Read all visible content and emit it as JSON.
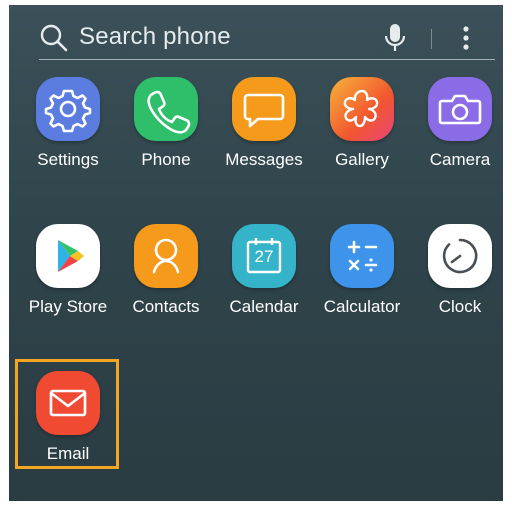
{
  "search": {
    "placeholder": "Search phone"
  },
  "icons": {
    "search": "search-icon",
    "mic": "mic-icon",
    "more": "more-vertical-icon"
  },
  "apps_row1": [
    {
      "label": "Settings",
      "icon": "gear-icon",
      "color": "#5b7de0"
    },
    {
      "label": "Phone",
      "icon": "phone-icon",
      "color": "#2fbf6a"
    },
    {
      "label": "Messages",
      "icon": "message-icon",
      "color": "#f59a1b"
    },
    {
      "label": "Gallery",
      "icon": "gallery-flower-icon",
      "color": "#f56a3a"
    },
    {
      "label": "Camera",
      "icon": "camera-icon",
      "color": "#8a6de6"
    }
  ],
  "apps_row2": [
    {
      "label": "Play Store",
      "icon": "play-store-icon",
      "color": "#ffffff"
    },
    {
      "label": "Contacts",
      "icon": "contact-person-icon",
      "color": "#f59a1b"
    },
    {
      "label": "Calendar",
      "icon": "calendar-icon",
      "color": "#35b4c9",
      "date": "27"
    },
    {
      "label": "Calculator",
      "icon": "calculator-icon",
      "color": "#3d94ea"
    },
    {
      "label": "Clock",
      "icon": "clock-icon",
      "color": "#ffffff"
    }
  ],
  "apps_row3": [
    {
      "label": "Email",
      "icon": "envelope-icon",
      "color": "#f04b32"
    }
  ],
  "highlight_color": "#f2a623"
}
